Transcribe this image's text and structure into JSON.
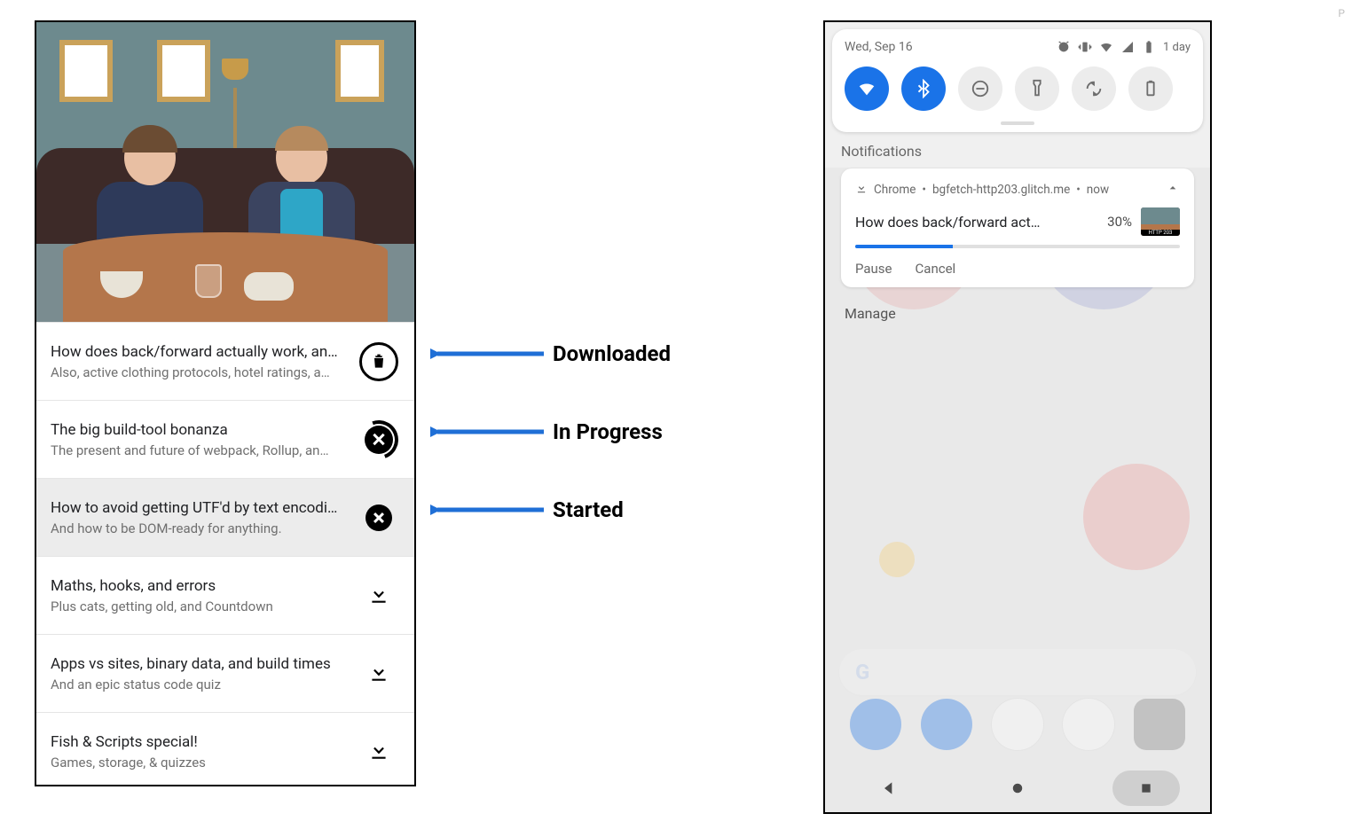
{
  "annotations": {
    "downloaded": "Downloaded",
    "in_progress": "In Progress",
    "started": "Started"
  },
  "left": {
    "episodes": [
      {
        "title": "How does back/forward actually work, an…",
        "subtitle": "Also, active clothing protocols, hotel ratings, a…",
        "action": "delete"
      },
      {
        "title": "The big build-tool bonanza",
        "subtitle": "The present and future of webpack, Rollup, an…",
        "action": "progress"
      },
      {
        "title": "How to avoid getting UTF'd by text encodi…",
        "subtitle": "And how to be DOM-ready for anything.",
        "action": "cancel",
        "selected": true
      },
      {
        "title": "Maths, hooks, and errors",
        "subtitle": "Plus cats, getting old, and Countdown",
        "action": "download"
      },
      {
        "title": "Apps vs sites, binary data, and build times",
        "subtitle": "And an epic status code quiz",
        "action": "download"
      },
      {
        "title": "Fish & Scripts special!",
        "subtitle": "Games, storage, & quizzes",
        "action": "download"
      }
    ]
  },
  "right": {
    "status": {
      "date": "Wed, Sep 16",
      "battery_text": "1 day"
    },
    "qs": [
      {
        "name": "wifi",
        "on": true
      },
      {
        "name": "bluetooth",
        "on": true
      },
      {
        "name": "dnd",
        "on": false
      },
      {
        "name": "flashlight",
        "on": false
      },
      {
        "name": "autorotate",
        "on": false
      },
      {
        "name": "battery-saver",
        "on": false
      }
    ],
    "notifications_heading": "Notifications",
    "notif": {
      "app": "Chrome",
      "origin": "bgfetch-http203.glitch.me",
      "time": "now",
      "title": "How does back/forward act…",
      "percent": "30%",
      "progress": 30,
      "thumb_label": "HTTP 203",
      "actions": {
        "pause": "Pause",
        "cancel": "Cancel"
      }
    },
    "manage": "Manage",
    "searchpill_logo": "G"
  },
  "page_indicator": "P"
}
